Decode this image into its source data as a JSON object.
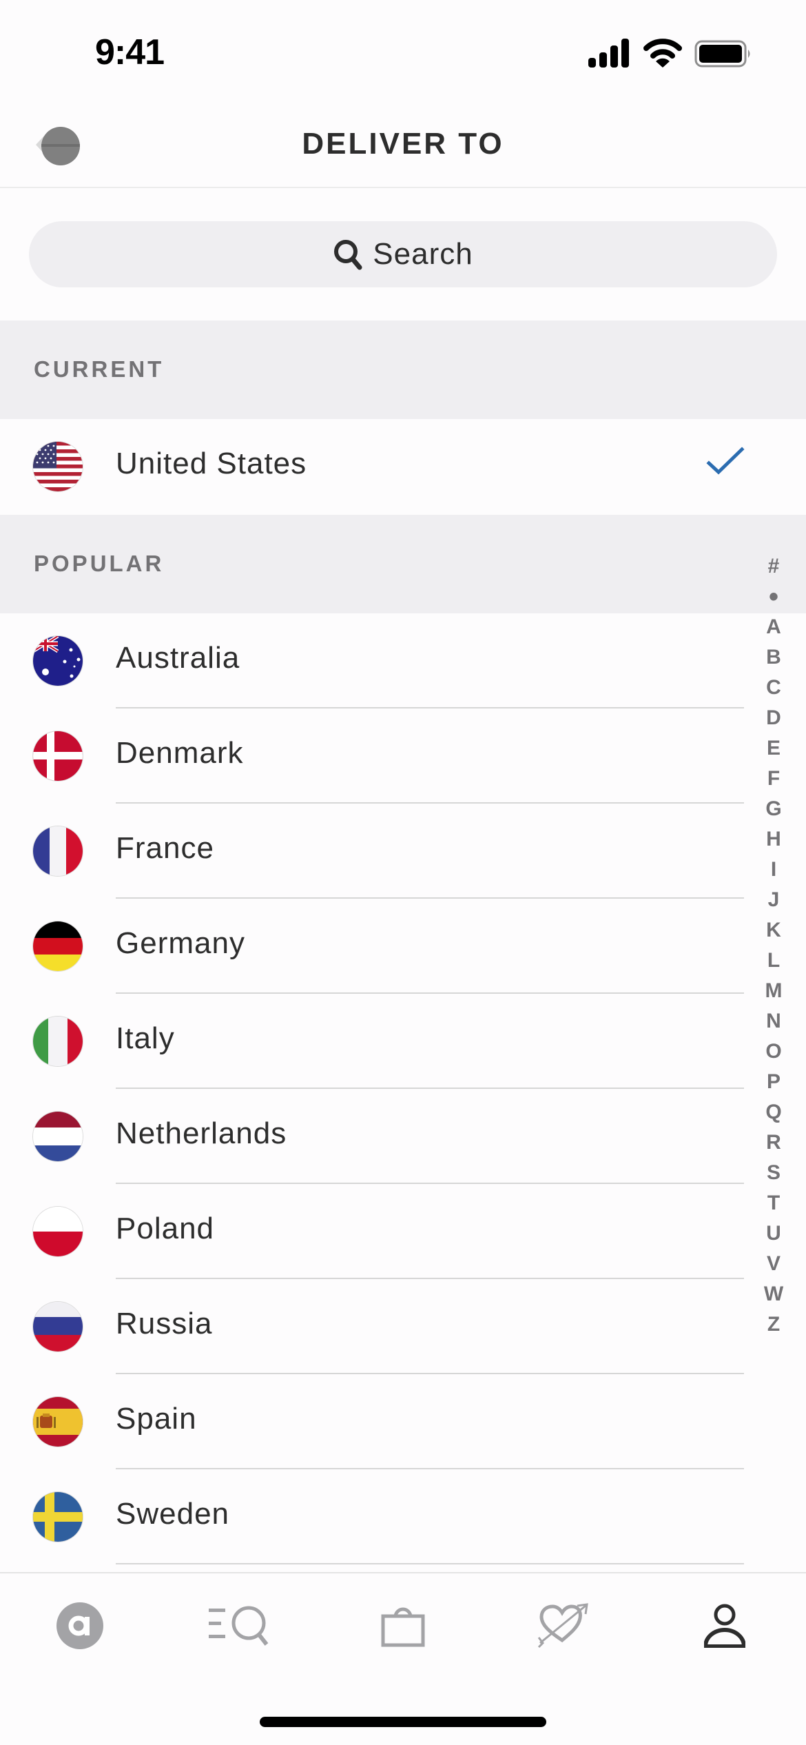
{
  "status_bar": {
    "time": "9:41",
    "icons": [
      "cellular-signal-icon",
      "wifi-icon",
      "battery-icon"
    ]
  },
  "header": {
    "title": "DELIVER TO",
    "back_icon": "back-icon"
  },
  "search": {
    "placeholder": "Search",
    "icon": "search-icon"
  },
  "sections": {
    "current": {
      "label": "CURRENT",
      "items": [
        {
          "name": "United States",
          "flag": "us-flag",
          "selected": true
        }
      ]
    },
    "popular": {
      "label": "POPULAR",
      "items": [
        {
          "name": "Australia",
          "flag": "au-flag"
        },
        {
          "name": "Denmark",
          "flag": "dk-flag"
        },
        {
          "name": "France",
          "flag": "fr-flag"
        },
        {
          "name": "Germany",
          "flag": "de-flag"
        },
        {
          "name": "Italy",
          "flag": "it-flag"
        },
        {
          "name": "Netherlands",
          "flag": "nl-flag"
        },
        {
          "name": "Poland",
          "flag": "pl-flag"
        },
        {
          "name": "Russia",
          "flag": "ru-flag"
        },
        {
          "name": "Spain",
          "flag": "es-flag"
        },
        {
          "name": "Sweden",
          "flag": "se-flag"
        }
      ]
    }
  },
  "alphabet_index": [
    "#",
    "•",
    "A",
    "B",
    "C",
    "D",
    "E",
    "F",
    "G",
    "H",
    "I",
    "J",
    "K",
    "L",
    "M",
    "N",
    "O",
    "P",
    "Q",
    "R",
    "S",
    "T",
    "U",
    "V",
    "W",
    "Z"
  ],
  "tab_bar": {
    "tabs": [
      {
        "name": "home",
        "icon": "home-logo-icon",
        "active": false
      },
      {
        "name": "search",
        "icon": "search-list-icon",
        "active": false
      },
      {
        "name": "bag",
        "icon": "shopping-bag-icon",
        "active": false
      },
      {
        "name": "saved",
        "icon": "heart-arrow-icon",
        "active": false
      },
      {
        "name": "account",
        "icon": "account-icon",
        "active": true
      }
    ]
  },
  "colors": {
    "accent_check": "#2b6cb0",
    "section_bg": "#efeef1",
    "tab_inactive": "#a3a3a6",
    "tab_active": "#2d2d2d"
  }
}
